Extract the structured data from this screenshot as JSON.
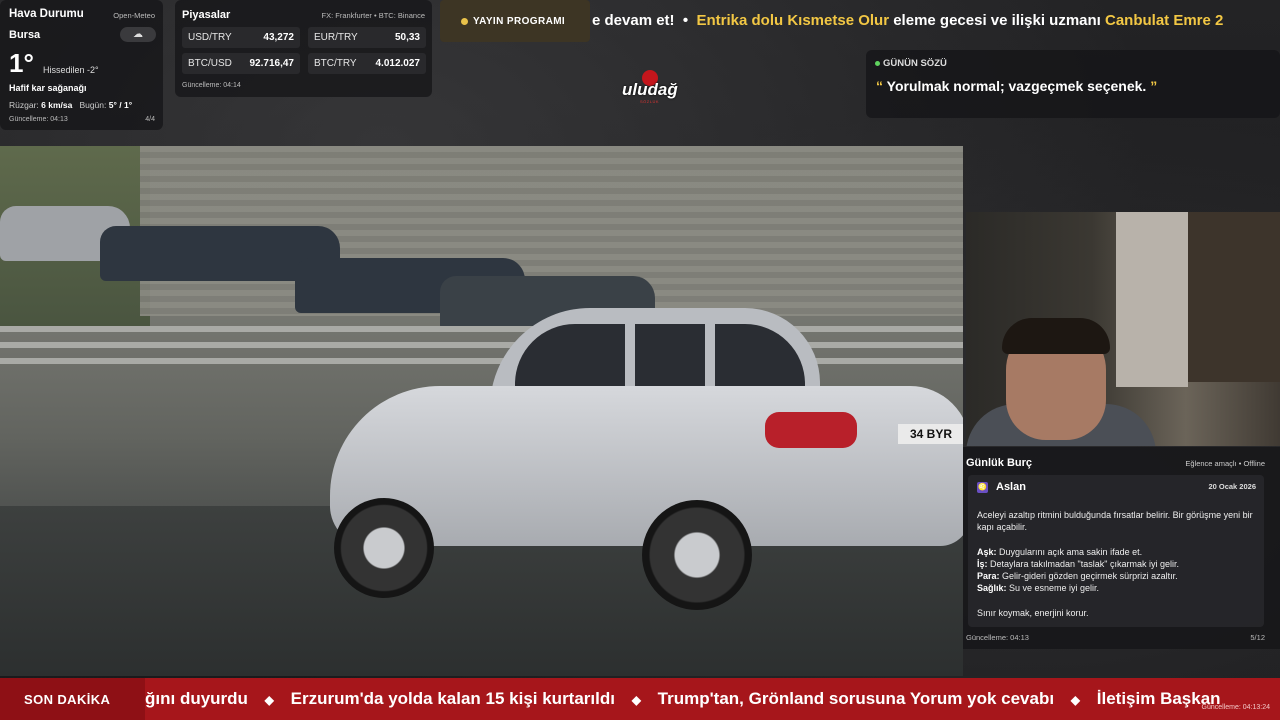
{
  "weather": {
    "title": "Hava Durumu",
    "source": "Open-Meteo",
    "city": "Bursa",
    "icon": "snow-cloud-icon",
    "icon_glyph": "☁",
    "temperature": "1°",
    "feels_like": "Hissedilen -2°",
    "condition": "Hafif kar sağanağı",
    "wind_label": "Rüzgar:",
    "wind_value": "6 km/sa",
    "today_label": "Bugün:",
    "today_value": "5° / 1°",
    "updated": "Güncelleme: 04:13",
    "page": "4/4"
  },
  "markets": {
    "title": "Piyasalar",
    "source": "FX: Frankfurter • BTC: Binance",
    "items": [
      {
        "label": "USD/TRY",
        "value": "43,272"
      },
      {
        "label": "EUR/TRY",
        "value": "50,33"
      },
      {
        "label": "BTC/USD",
        "value": "92.716,47"
      },
      {
        "label": "BTC/TRY",
        "value": "4.012.027"
      }
    ],
    "updated": "Güncelleme: 04:14"
  },
  "schedule": {
    "label": "YAYIN PROGRAMI"
  },
  "top_ticker": {
    "part1": "e devam et!",
    "sep": "•",
    "highlight": "Entrika dolu Kısmetse Olur",
    "part2": " eleme gecesi ve ilişki uzmanı ",
    "highlight2": "Canbulat Emre 2"
  },
  "logo": {
    "text": "uludağ",
    "sub": "SÖZLÜK"
  },
  "quote": {
    "title": "GÜNÜN SÖZÜ",
    "open": "“",
    "text": "Yorulmak normal; vazgeçmek seçenek.",
    "close": "”"
  },
  "video": {
    "plate": "34 BYR"
  },
  "horoscope": {
    "title": "Günlük Burç",
    "meta": "Eğlence amaçlı • Offline",
    "sign_icon": "♌",
    "sign": "Aslan",
    "date": "20 Ocak 2026",
    "intro": "Aceleyi azaltıp ritmini bulduğunda fırsatlar belirir. Bir görüşme yeni bir kapı açabilir.",
    "love_label": "Aşk:",
    "love": " Duygularını açık ama sakin ifade et.",
    "work_label": "İş:",
    "work": " Detaylara takılmadan \"taslak\" çıkarmak iyi gelir.",
    "money_label": "Para:",
    "money": " Gelir-gideri gözden geçirmek sürprizi azaltır.",
    "health_label": "Sağlık:",
    "health": " Su ve esneme iyi gelir.",
    "closing": "Sınır koymak, enerjini korur.",
    "updated": "Güncelleme: 04:13",
    "page": "5/12"
  },
  "bottom_ticker": {
    "tag": "SON DAKİKA",
    "items": [
      "ğını duyurdu",
      "Erzurum'da yolda kalan 15 kişi kurtarıldı",
      "Trump'tan, Grönland sorusuna Yorum yok cevabı",
      "İletişim Başkan"
    ],
    "sep": "◆",
    "updated": "Güncelleme: 04:13:24"
  },
  "colors": {
    "accent": "#f2c744",
    "breaking": "#a6161b",
    "quote_dot": "#5fd35f"
  }
}
